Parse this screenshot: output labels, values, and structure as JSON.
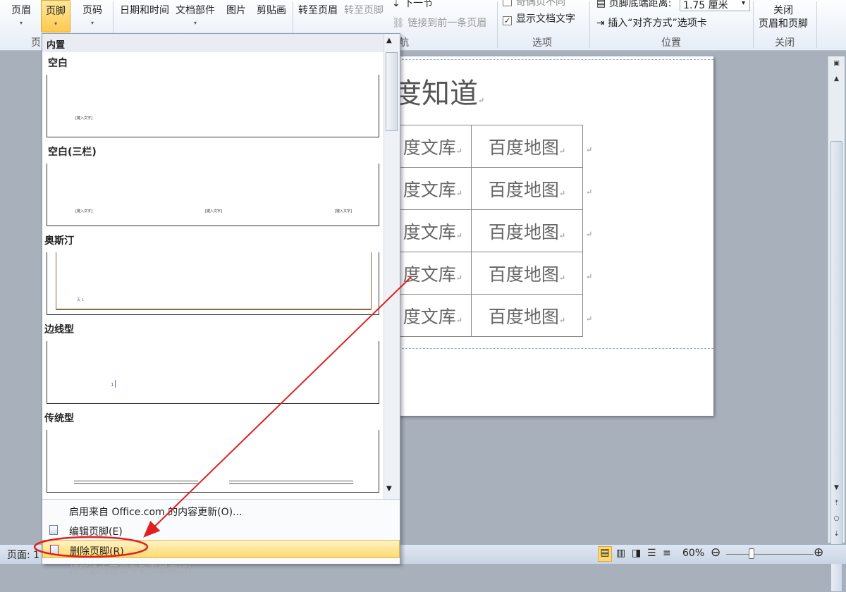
{
  "ribbon": {
    "buttons": {
      "header": "页眉",
      "footer": "页脚",
      "page_number": "页码",
      "date_time": "日期和时间",
      "quick_parts": "文档部件",
      "picture": "图片",
      "clip_art": "剪贴画",
      "goto_header": "转至页眉",
      "goto_footer": "转至页脚",
      "next_section": "下一节",
      "link_previous": "链接到前一条页眉",
      "close_line1": "关闭",
      "close_line2": "页眉和页脚"
    },
    "groups": {
      "header_footer": "页",
      "navigation": "航",
      "options": "选项",
      "position": "位置",
      "close": "关闭"
    },
    "options": {
      "odd_even": "奇偶页不同",
      "show_doc_text": "显示文档文字",
      "show_doc_text_checked": true
    },
    "position": {
      "footer_distance_label": "页脚底端距离:",
      "footer_distance_value": "1.75 厘米",
      "insert_align_tab": "插入“对齐方式”选项卡"
    }
  },
  "document": {
    "title": "度知道",
    "table": [
      [
        "度文库",
        "百度地图"
      ],
      [
        "度文库",
        "百度地图"
      ],
      [
        "度文库",
        "百度地图"
      ],
      [
        "度文库",
        "百度地图"
      ],
      [
        "度文库",
        "百度地图"
      ]
    ],
    "paragraph_mark": "↵"
  },
  "dropdown": {
    "section_header": "内置",
    "gallery": [
      {
        "label": "空白",
        "placeholders": [
          "[键入文字]"
        ]
      },
      {
        "label": "空白(三栏)",
        "placeholders": [
          "[键入文字]",
          "[键入文字]",
          "[键入文字]"
        ]
      },
      {
        "label": "奥斯汀",
        "placeholders": [
          "页 1"
        ]
      },
      {
        "label": "边线型",
        "placeholders": [
          "1"
        ]
      },
      {
        "label": "传统型",
        "placeholders": []
      }
    ],
    "menu": {
      "update_office": "启用来自 Office.com 的内容更新(O)...",
      "edit_footer": "编辑页脚(E)",
      "remove_footer": "删除页脚(R)",
      "save_selection": "将所选内容保存到页脚库(S)..."
    }
  },
  "status_bar": {
    "page_label": "页面: 1",
    "zoom": "60%"
  },
  "colors": {
    "annotation_red": "#e02020",
    "active_button": "#ffc94d"
  }
}
